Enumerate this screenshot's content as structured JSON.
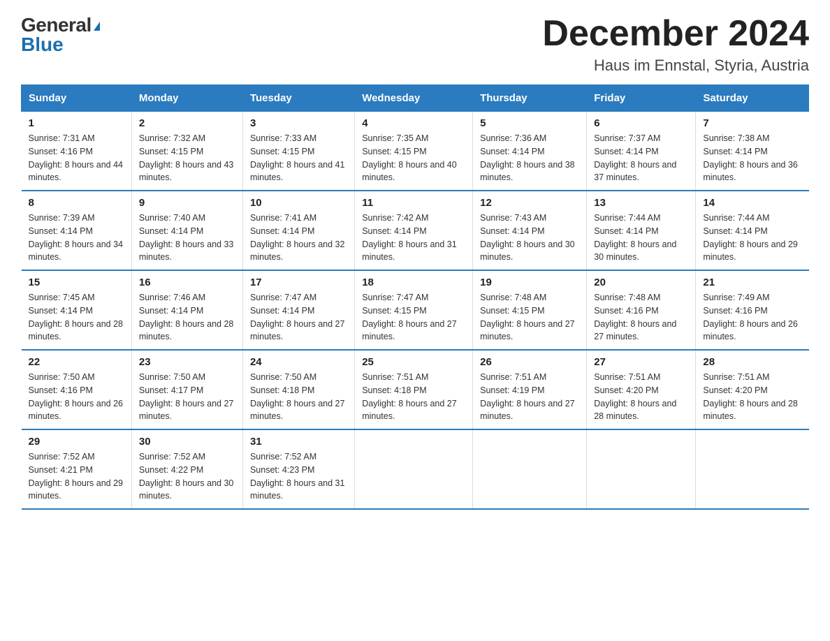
{
  "logo": {
    "top": "General",
    "triangle": "▶",
    "bottom": "Blue"
  },
  "title": "December 2024",
  "subtitle": "Haus im Ennstal, Styria, Austria",
  "days_of_week": [
    "Sunday",
    "Monday",
    "Tuesday",
    "Wednesday",
    "Thursday",
    "Friday",
    "Saturday"
  ],
  "weeks": [
    [
      {
        "day": "1",
        "sunrise": "7:31 AM",
        "sunset": "4:16 PM",
        "daylight": "8 hours and 44 minutes."
      },
      {
        "day": "2",
        "sunrise": "7:32 AM",
        "sunset": "4:15 PM",
        "daylight": "8 hours and 43 minutes."
      },
      {
        "day": "3",
        "sunrise": "7:33 AM",
        "sunset": "4:15 PM",
        "daylight": "8 hours and 41 minutes."
      },
      {
        "day": "4",
        "sunrise": "7:35 AM",
        "sunset": "4:15 PM",
        "daylight": "8 hours and 40 minutes."
      },
      {
        "day": "5",
        "sunrise": "7:36 AM",
        "sunset": "4:14 PM",
        "daylight": "8 hours and 38 minutes."
      },
      {
        "day": "6",
        "sunrise": "7:37 AM",
        "sunset": "4:14 PM",
        "daylight": "8 hours and 37 minutes."
      },
      {
        "day": "7",
        "sunrise": "7:38 AM",
        "sunset": "4:14 PM",
        "daylight": "8 hours and 36 minutes."
      }
    ],
    [
      {
        "day": "8",
        "sunrise": "7:39 AM",
        "sunset": "4:14 PM",
        "daylight": "8 hours and 34 minutes."
      },
      {
        "day": "9",
        "sunrise": "7:40 AM",
        "sunset": "4:14 PM",
        "daylight": "8 hours and 33 minutes."
      },
      {
        "day": "10",
        "sunrise": "7:41 AM",
        "sunset": "4:14 PM",
        "daylight": "8 hours and 32 minutes."
      },
      {
        "day": "11",
        "sunrise": "7:42 AM",
        "sunset": "4:14 PM",
        "daylight": "8 hours and 31 minutes."
      },
      {
        "day": "12",
        "sunrise": "7:43 AM",
        "sunset": "4:14 PM",
        "daylight": "8 hours and 30 minutes."
      },
      {
        "day": "13",
        "sunrise": "7:44 AM",
        "sunset": "4:14 PM",
        "daylight": "8 hours and 30 minutes."
      },
      {
        "day": "14",
        "sunrise": "7:44 AM",
        "sunset": "4:14 PM",
        "daylight": "8 hours and 29 minutes."
      }
    ],
    [
      {
        "day": "15",
        "sunrise": "7:45 AM",
        "sunset": "4:14 PM",
        "daylight": "8 hours and 28 minutes."
      },
      {
        "day": "16",
        "sunrise": "7:46 AM",
        "sunset": "4:14 PM",
        "daylight": "8 hours and 28 minutes."
      },
      {
        "day": "17",
        "sunrise": "7:47 AM",
        "sunset": "4:14 PM",
        "daylight": "8 hours and 27 minutes."
      },
      {
        "day": "18",
        "sunrise": "7:47 AM",
        "sunset": "4:15 PM",
        "daylight": "8 hours and 27 minutes."
      },
      {
        "day": "19",
        "sunrise": "7:48 AM",
        "sunset": "4:15 PM",
        "daylight": "8 hours and 27 minutes."
      },
      {
        "day": "20",
        "sunrise": "7:48 AM",
        "sunset": "4:16 PM",
        "daylight": "8 hours and 27 minutes."
      },
      {
        "day": "21",
        "sunrise": "7:49 AM",
        "sunset": "4:16 PM",
        "daylight": "8 hours and 26 minutes."
      }
    ],
    [
      {
        "day": "22",
        "sunrise": "7:50 AM",
        "sunset": "4:16 PM",
        "daylight": "8 hours and 26 minutes."
      },
      {
        "day": "23",
        "sunrise": "7:50 AM",
        "sunset": "4:17 PM",
        "daylight": "8 hours and 27 minutes."
      },
      {
        "day": "24",
        "sunrise": "7:50 AM",
        "sunset": "4:18 PM",
        "daylight": "8 hours and 27 minutes."
      },
      {
        "day": "25",
        "sunrise": "7:51 AM",
        "sunset": "4:18 PM",
        "daylight": "8 hours and 27 minutes."
      },
      {
        "day": "26",
        "sunrise": "7:51 AM",
        "sunset": "4:19 PM",
        "daylight": "8 hours and 27 minutes."
      },
      {
        "day": "27",
        "sunrise": "7:51 AM",
        "sunset": "4:20 PM",
        "daylight": "8 hours and 28 minutes."
      },
      {
        "day": "28",
        "sunrise": "7:51 AM",
        "sunset": "4:20 PM",
        "daylight": "8 hours and 28 minutes."
      }
    ],
    [
      {
        "day": "29",
        "sunrise": "7:52 AM",
        "sunset": "4:21 PM",
        "daylight": "8 hours and 29 minutes."
      },
      {
        "day": "30",
        "sunrise": "7:52 AM",
        "sunset": "4:22 PM",
        "daylight": "8 hours and 30 minutes."
      },
      {
        "day": "31",
        "sunrise": "7:52 AM",
        "sunset": "4:23 PM",
        "daylight": "8 hours and 31 minutes."
      },
      null,
      null,
      null,
      null
    ]
  ]
}
